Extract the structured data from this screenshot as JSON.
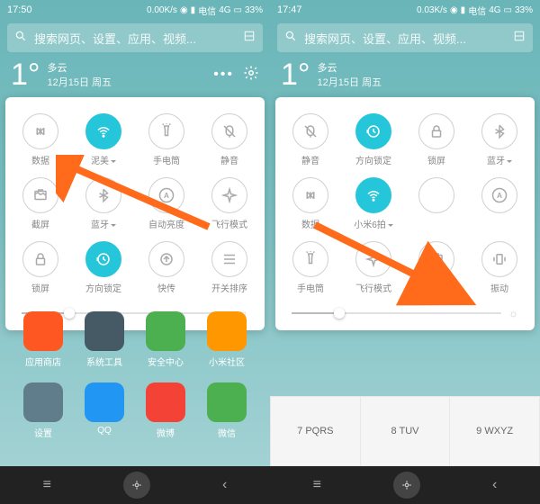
{
  "left": {
    "status": {
      "time": "17:50",
      "speed": "0.00K/s",
      "carrier": "电信",
      "net": "4G",
      "battery": "33%"
    },
    "search": {
      "placeholder": "搜索网页、设置、应用、视频..."
    },
    "weather": {
      "temp": "1°",
      "condition": "多云",
      "date": "12月15日 周五"
    },
    "tiles": [
      {
        "label": "数据",
        "icon": "data",
        "on": false,
        "tri": false
      },
      {
        "label": "泥美",
        "icon": "wifi",
        "on": true,
        "tri": true
      },
      {
        "label": "手电筒",
        "icon": "torch",
        "on": false,
        "tri": false
      },
      {
        "label": "静音",
        "icon": "mute",
        "on": false,
        "tri": false
      },
      {
        "label": "截屏",
        "icon": "screenshot",
        "on": false,
        "tri": false
      },
      {
        "label": "蓝牙",
        "icon": "bluetooth",
        "on": false,
        "tri": true
      },
      {
        "label": "自动亮度",
        "icon": "auto",
        "on": false,
        "tri": false
      },
      {
        "label": "飞行模式",
        "icon": "airplane",
        "on": false,
        "tri": false
      },
      {
        "label": "锁屏",
        "icon": "lock",
        "on": false,
        "tri": false
      },
      {
        "label": "方向锁定",
        "icon": "rotate",
        "on": true,
        "tri": false
      },
      {
        "label": "快传",
        "icon": "transfer",
        "on": false,
        "tri": false
      },
      {
        "label": "开关排序",
        "icon": "sort",
        "on": false,
        "tri": false
      }
    ],
    "slider_pct": 20,
    "apps": [
      {
        "label": "应用商店",
        "color": "#ff5722"
      },
      {
        "label": "系统工具",
        "color": "#455a64"
      },
      {
        "label": "安全中心",
        "color": "#4caf50"
      },
      {
        "label": "小米社区",
        "color": "#ff9800"
      },
      {
        "label": "设置",
        "color": "#607d8b"
      },
      {
        "label": "QQ",
        "color": "#2196f3"
      },
      {
        "label": "微博",
        "color": "#f44336"
      },
      {
        "label": "微信",
        "color": "#4caf50"
      }
    ],
    "dock": [
      {
        "color": "#4caf50"
      },
      {
        "color": "#ffc107"
      },
      {
        "color": "#03a9f4"
      },
      {
        "color": "#9e9e9e"
      }
    ]
  },
  "right": {
    "status": {
      "time": "17:47",
      "speed": "0.03K/s",
      "carrier": "电信",
      "net": "4G",
      "battery": "33%"
    },
    "search": {
      "placeholder": "搜索网页、设置、应用、视频..."
    },
    "weather": {
      "temp": "1°",
      "condition": "多云",
      "date": "12月15日 周五"
    },
    "tiles": [
      {
        "label": "静音",
        "icon": "mute",
        "on": false,
        "tri": false
      },
      {
        "label": "方向锁定",
        "icon": "rotate",
        "on": true,
        "tri": false
      },
      {
        "label": "锁屏",
        "icon": "lock",
        "on": false,
        "tri": false
      },
      {
        "label": "蓝牙",
        "icon": "bluetooth",
        "on": false,
        "tri": true
      },
      {
        "label": "数据",
        "icon": "data",
        "on": false,
        "tri": false
      },
      {
        "label": "小米6拍",
        "icon": "wifi",
        "on": true,
        "tri": true
      },
      {
        "label": "",
        "icon": "empty",
        "on": false,
        "tri": false
      },
      {
        "label": "",
        "icon": "auto",
        "on": false,
        "tri": false
      },
      {
        "label": "手电筒",
        "icon": "torch",
        "on": false,
        "tri": false
      },
      {
        "label": "飞行模式",
        "icon": "airplane",
        "on": false,
        "tri": false
      },
      {
        "label": "截屏",
        "icon": "screenshot",
        "on": false,
        "tri": false
      },
      {
        "label": "振动",
        "icon": "vibrate",
        "on": false,
        "tri": false
      }
    ],
    "slider_pct": 20,
    "keys": [
      "7 PQRS",
      "8 TUV",
      "9 WXYZ"
    ]
  }
}
